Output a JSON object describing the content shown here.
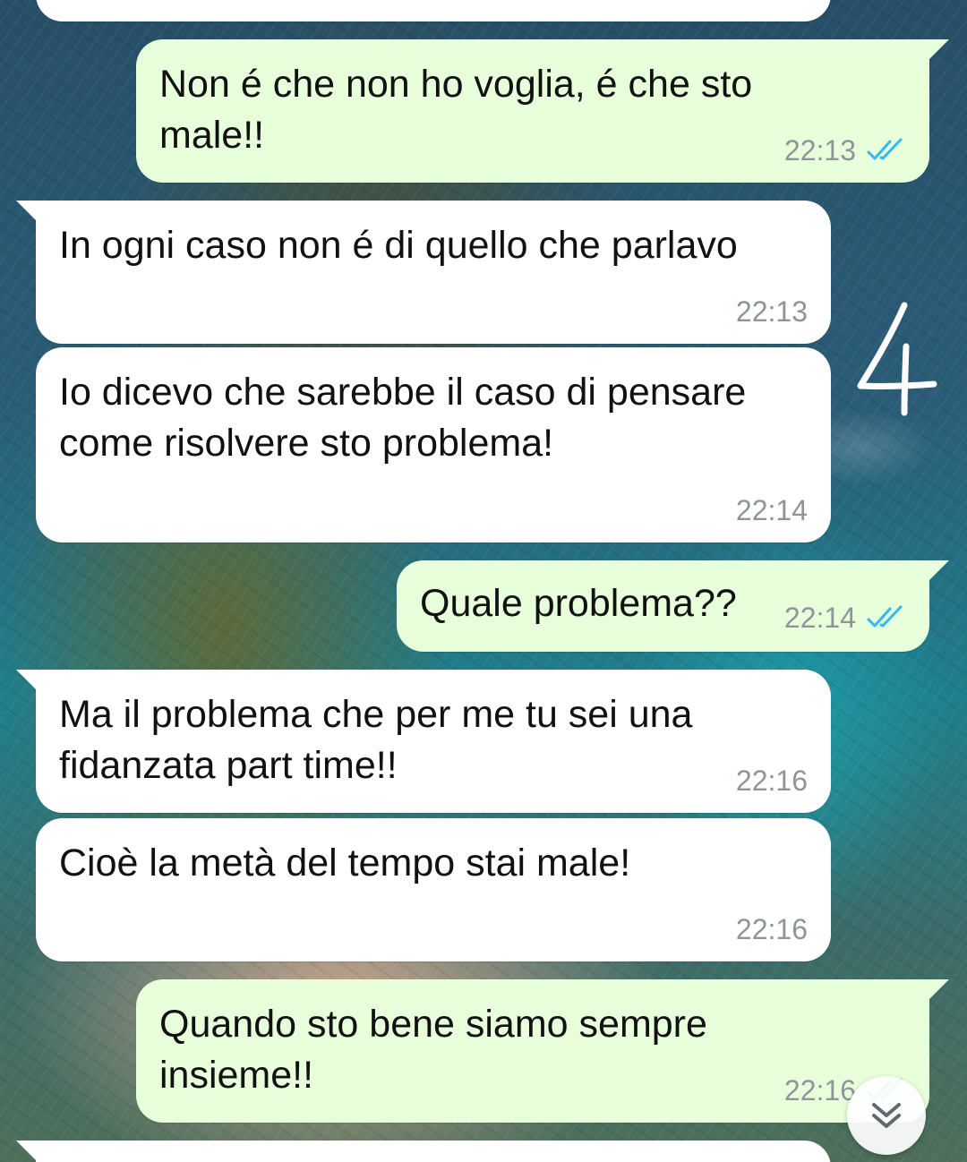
{
  "messages": [
    {
      "direction": "in",
      "text": "",
      "time": ""
    },
    {
      "direction": "out",
      "text": "Non é che non ho voglia, é che sto male!!",
      "time": "22:13",
      "status": "read"
    },
    {
      "direction": "in",
      "text": "In ogni caso non é di quello che parlavo",
      "time": "22:13"
    },
    {
      "direction": "in",
      "text": "Io dicevo che sarebbe il caso di pensare come risolvere sto problema!",
      "time": "22:14"
    },
    {
      "direction": "out",
      "text": "Quale problema??",
      "time": "22:14",
      "status": "read"
    },
    {
      "direction": "in",
      "text": "Ma il problema che per me tu sei una fidanzata part time!!",
      "time": "22:16"
    },
    {
      "direction": "in",
      "text": "Cioè la metà del tempo stai male!",
      "time": "22:16"
    },
    {
      "direction": "out",
      "text": "Quando sto bene siamo sempre insieme!!",
      "time": "22:16",
      "status": "read"
    },
    {
      "direction": "in",
      "text": "",
      "time": ""
    }
  ],
  "annotation": {
    "label": "4"
  },
  "icons": {
    "read_receipt": "double-check-icon",
    "scroll_down": "double-chevron-down-icon"
  },
  "colors": {
    "incoming_bubble": "#ffffff",
    "outgoing_bubble": "#e7ffdb",
    "read_ticks": "#34b7f1",
    "time_text": "#8d9598"
  }
}
